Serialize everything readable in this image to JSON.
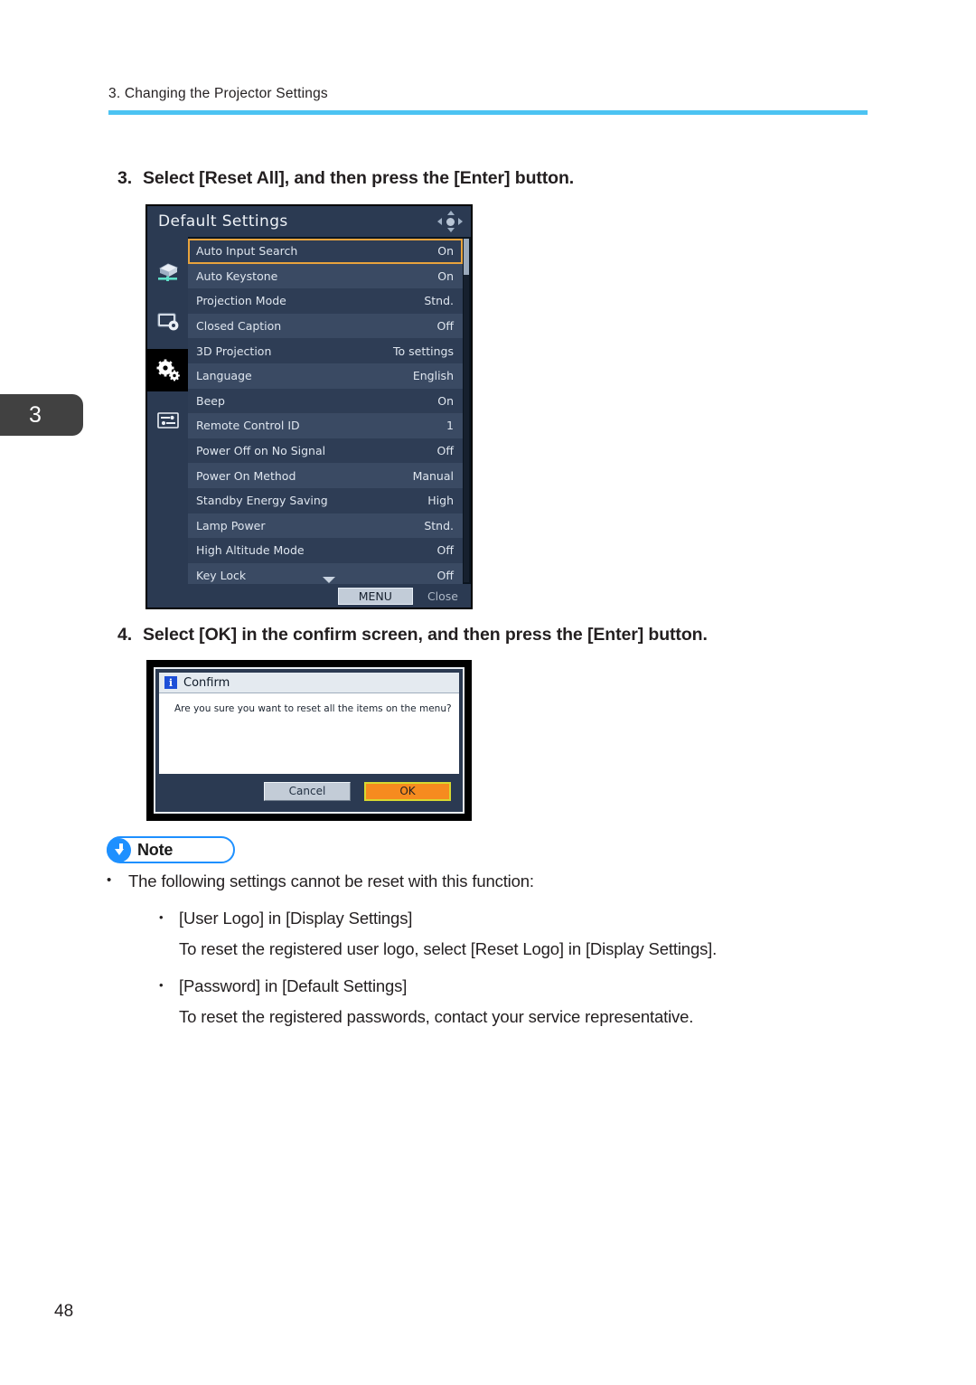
{
  "header": {
    "running_title": "3. Changing the Projector Settings",
    "rule_color": "#4CC3F2"
  },
  "chapter_tab": {
    "number": "3"
  },
  "steps": [
    {
      "number": "3.",
      "text": "Select [Reset All], and then press the [Enter] button."
    },
    {
      "number": "4.",
      "text": "Select [OK] in the confirm screen, and then press the [Enter] button."
    }
  ],
  "osd_menu": {
    "title": "Default Settings",
    "navpad_icon": "dpad-icon",
    "sidebar_icons": [
      {
        "name": "projector-icon",
        "active": false
      },
      {
        "name": "screen-settings-icon",
        "active": false
      },
      {
        "name": "gears-icon",
        "active": true
      },
      {
        "name": "sliders-icon",
        "active": false
      }
    ],
    "rows": [
      {
        "label": "Auto Input Search",
        "value": "On",
        "selected": true
      },
      {
        "label": "Auto Keystone",
        "value": "On",
        "selected": false
      },
      {
        "label": "Projection Mode",
        "value": "Stnd.",
        "selected": false
      },
      {
        "label": "Closed Caption",
        "value": "Off",
        "selected": false
      },
      {
        "label": "3D Projection",
        "value": "To settings",
        "selected": false
      },
      {
        "label": "Language",
        "value": "English",
        "selected": false
      },
      {
        "label": "Beep",
        "value": "On",
        "selected": false
      },
      {
        "label": "Remote Control ID",
        "value": "1",
        "selected": false
      },
      {
        "label": "Power Off on No Signal",
        "value": "Off",
        "selected": false
      },
      {
        "label": "Power On Method",
        "value": "Manual",
        "selected": false
      },
      {
        "label": "Standby Energy Saving",
        "value": "High",
        "selected": false
      },
      {
        "label": "Lamp Power",
        "value": "Stnd.",
        "selected": false
      },
      {
        "label": "High Altitude Mode",
        "value": "Off",
        "selected": false
      },
      {
        "label": "Key Lock",
        "value": "Off",
        "selected": false
      }
    ],
    "footer": {
      "menu_button": "MENU",
      "close_label": "Close"
    },
    "selection_color": "#E8A33D",
    "background_color": "#2b3a52"
  },
  "confirm_dialog": {
    "icon": "info-icon",
    "icon_glyph": "i",
    "title": "Confirm",
    "message": "Are you sure you want to reset all the items on the menu?",
    "buttons": {
      "cancel": "Cancel",
      "ok": "OK"
    },
    "ok_color": "#F68B1F"
  },
  "note": {
    "badge_label": "Note",
    "badge_icon": "down-arrow-icon",
    "badge_color": "#1E90FF",
    "lines": {
      "intro": "The following settings cannot be reset with this function:",
      "item1": "[User Logo] in [Display Settings]",
      "item1_detail": "To reset the registered user logo, select [Reset Logo] in [Display Settings].",
      "item2": "[Password] in [Default Settings]",
      "item2_detail": "To reset the registered passwords, contact your service representative."
    },
    "bullet": "•"
  },
  "footer": {
    "page_number": "48"
  }
}
